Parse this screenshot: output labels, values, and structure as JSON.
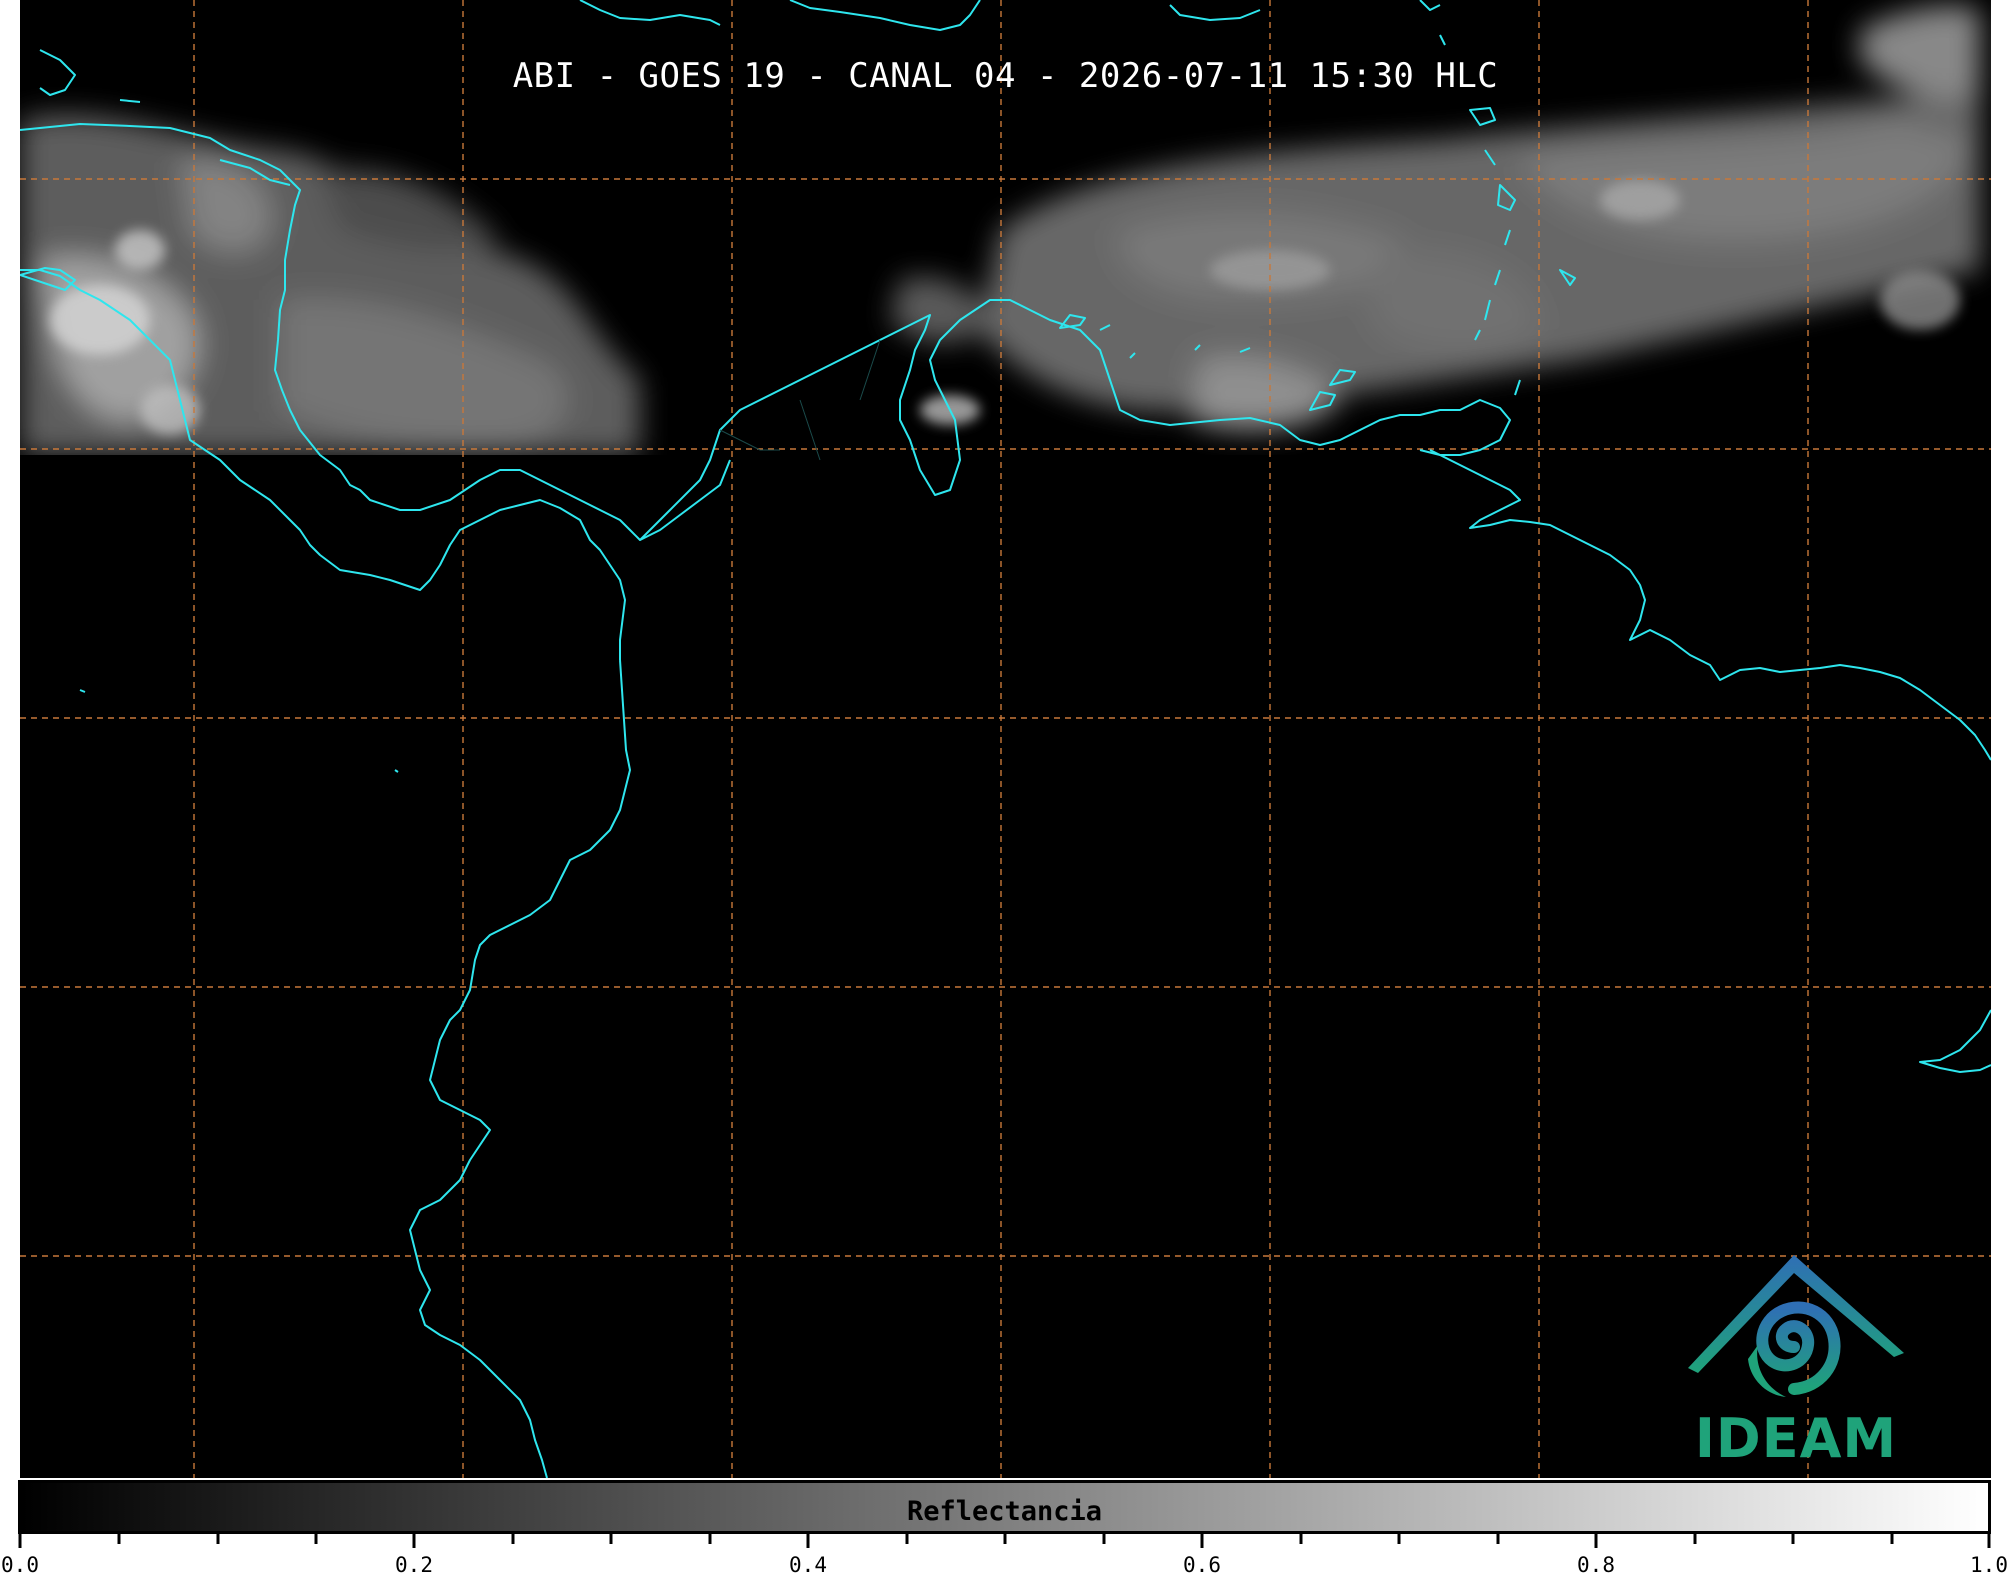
{
  "title": "ABI - GOES 19 - CANAL 04 - 2026-07-11 15:30 HLC",
  "colorbar": {
    "label": "Reflectancia",
    "min": 0.0,
    "max": 1.0,
    "tick_labels": [
      "0.0",
      "0.2",
      "0.4",
      "0.6",
      "0.8",
      "1.0"
    ]
  },
  "logo": {
    "text": "IDEAM"
  },
  "colors": {
    "coastline": "#2ee6ee",
    "grid": "#c8783a",
    "background": "#000000",
    "logo_green": "#1fa37a",
    "logo_blue": "#2f6fb5"
  }
}
